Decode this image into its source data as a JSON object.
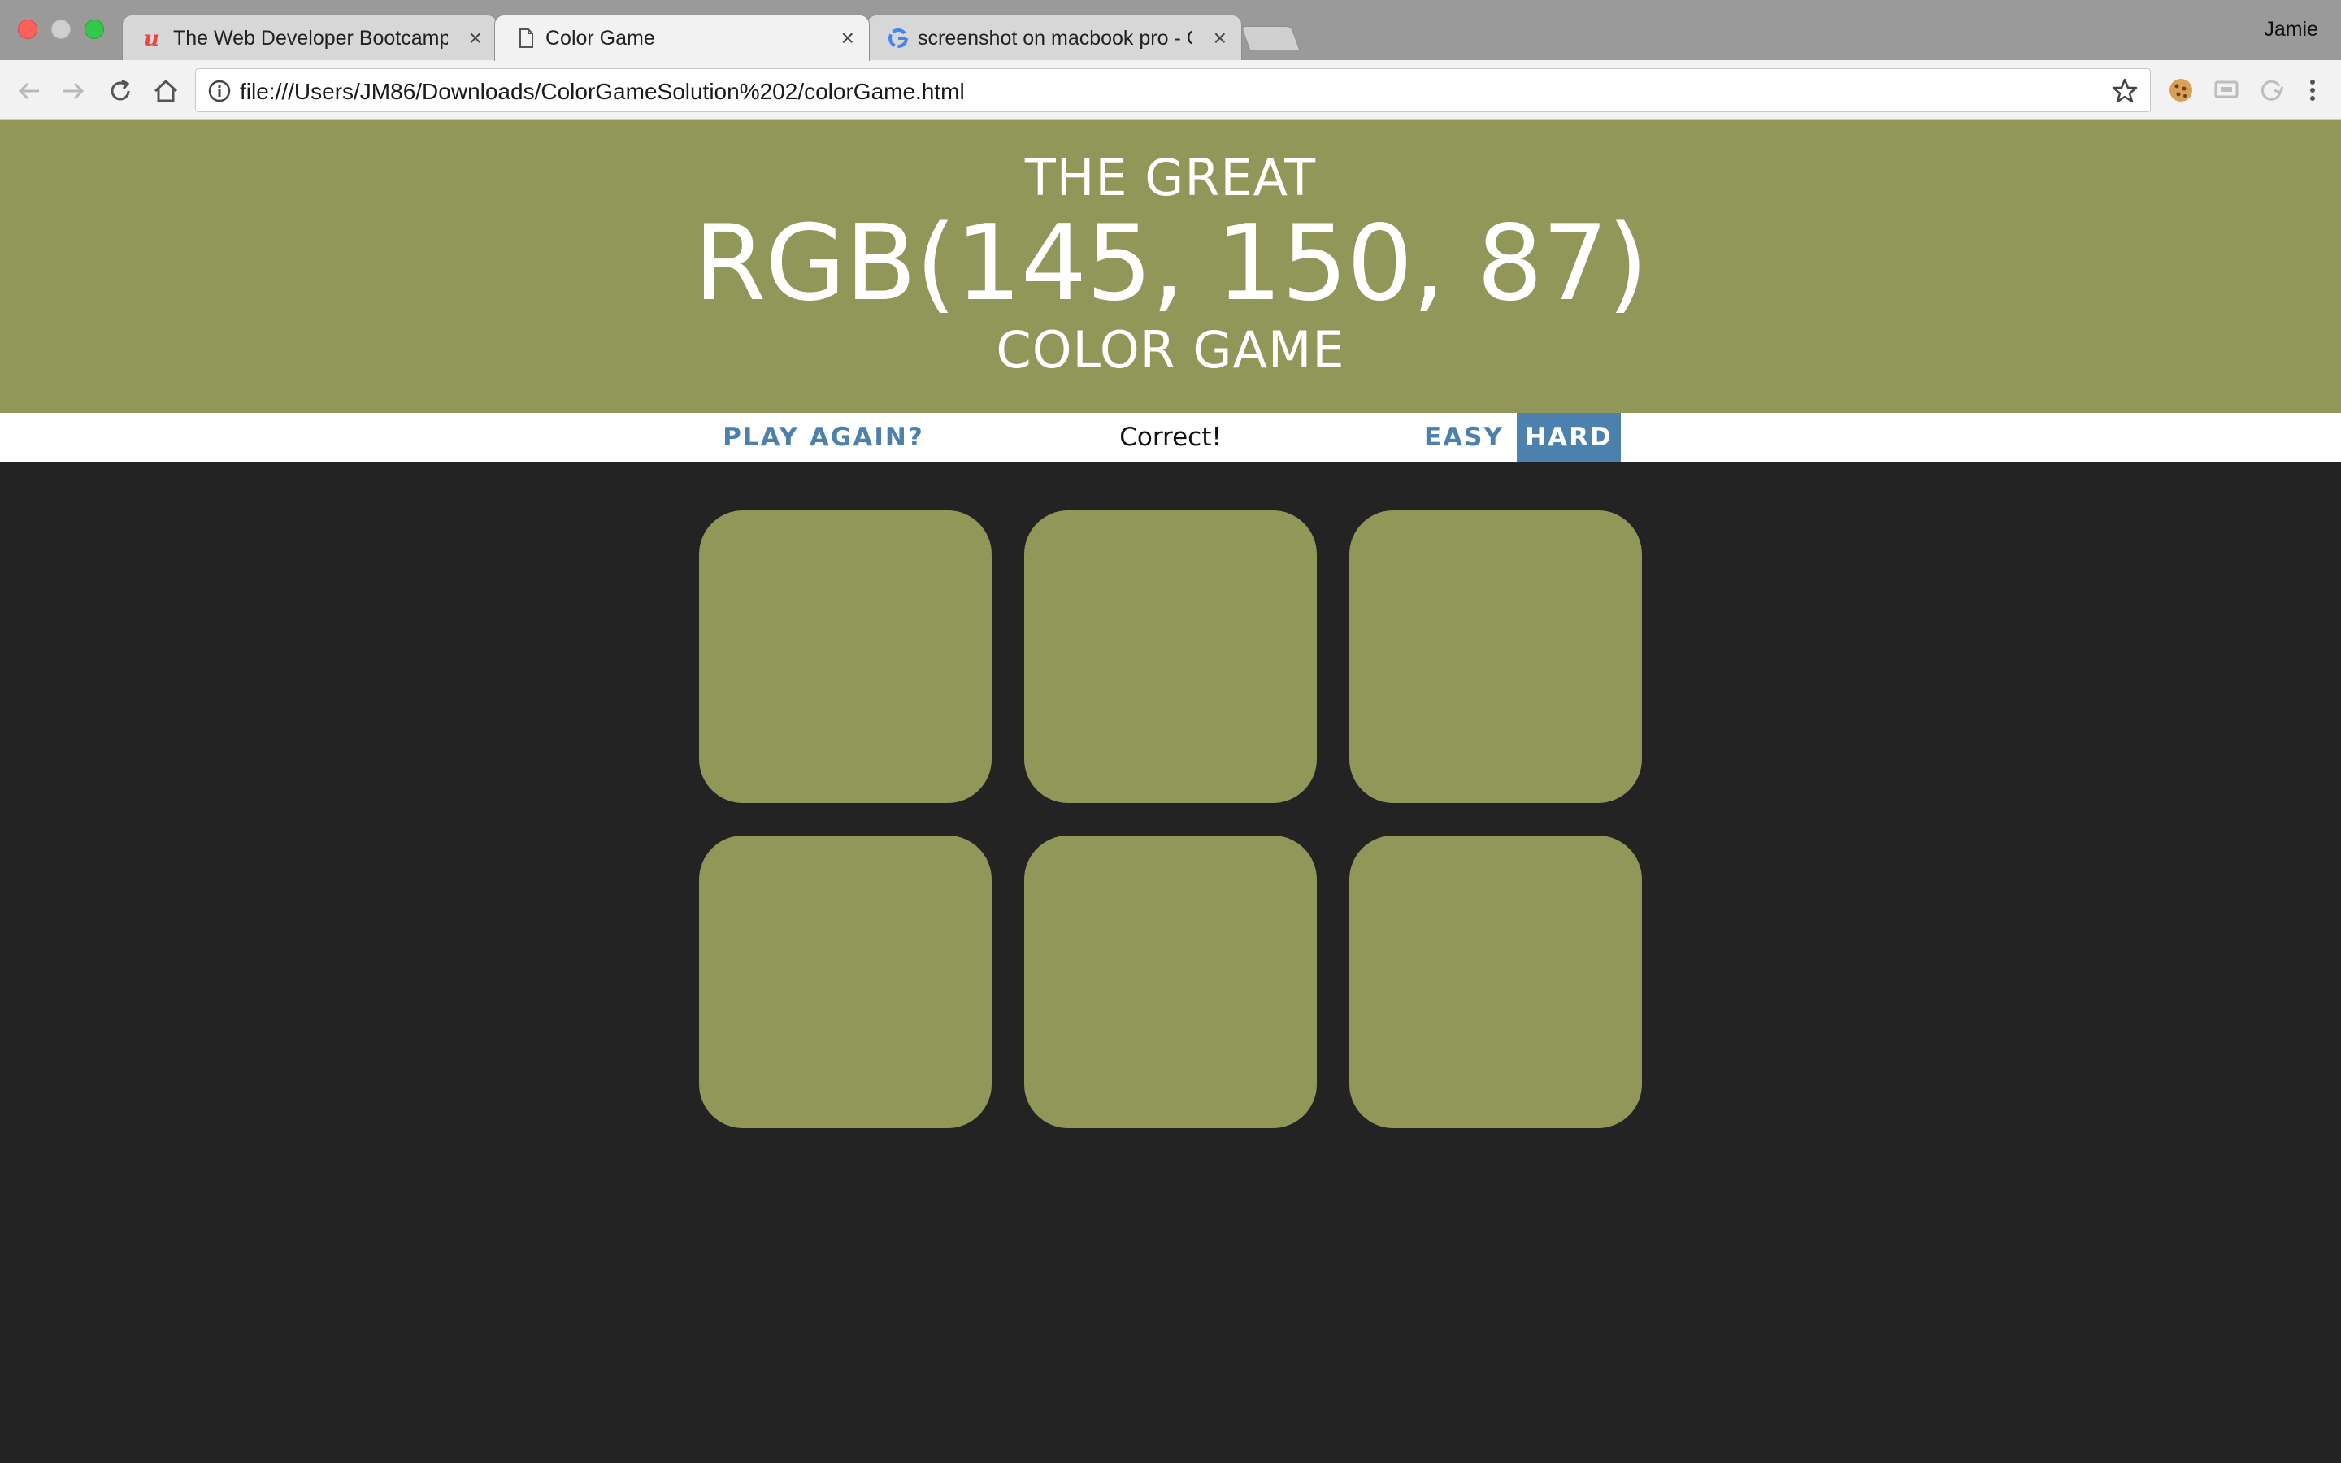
{
  "browser": {
    "tabs": [
      {
        "title": "The Web Developer Bootcamp",
        "icon": "udemy-icon",
        "active": false
      },
      {
        "title": "Color Game",
        "icon": "document-icon",
        "active": true
      },
      {
        "title": "screenshot on macbook pro - G",
        "icon": "google-icon",
        "active": false
      }
    ],
    "close_glyph": "×",
    "profile": "Jamie",
    "url": "file:///Users/JM86/Downloads/ColorGameSolution%202/colorGame.html"
  },
  "game": {
    "title_top": "THE GREAT",
    "rgb_display": "RGB(145, 150, 87)",
    "title_bottom": "COLOR GAME",
    "header_color": "#919659",
    "new_colors_label": "PLAY AGAIN?",
    "message": "Correct!",
    "mode_buttons": [
      {
        "label": "EASY",
        "selected": false
      },
      {
        "label": "HARD",
        "selected": true
      }
    ],
    "squares": [
      {
        "color": "#919659"
      },
      {
        "color": "#919659"
      },
      {
        "color": "#919659"
      },
      {
        "color": "#919659"
      },
      {
        "color": "#919659"
      },
      {
        "color": "#919659"
      }
    ]
  },
  "colors": {
    "accent": "#4d81ad",
    "background": "#232323",
    "stripe": "#ffffff"
  }
}
